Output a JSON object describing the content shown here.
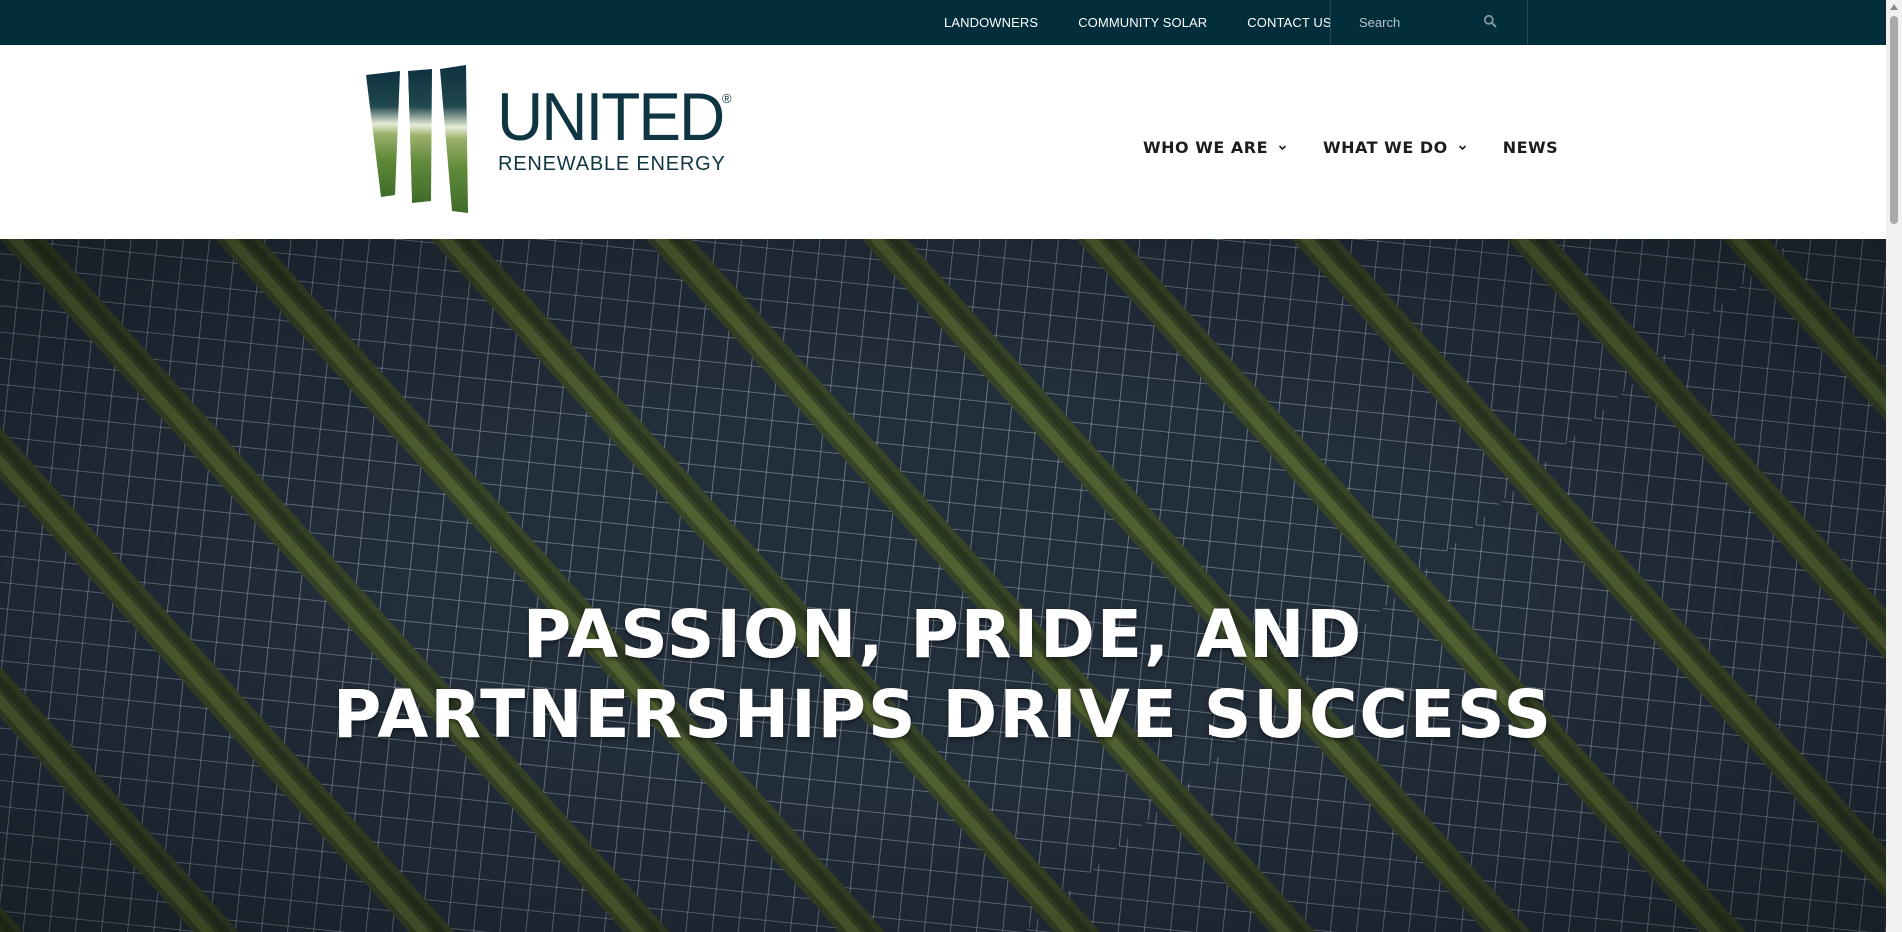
{
  "topbar": {
    "links": [
      {
        "label": "LANDOWNERS"
      },
      {
        "label": "COMMUNITY SOLAR"
      },
      {
        "label": "CONTACT US"
      }
    ],
    "search": {
      "placeholder": "Search",
      "icon": "search-icon"
    }
  },
  "logo": {
    "word": "UNITED",
    "subtitle": "RENEWABLE ENERGY",
    "registered": "®"
  },
  "nav": {
    "items": [
      {
        "label": "WHO WE ARE",
        "has_dropdown": true
      },
      {
        "label": "WHAT WE DO",
        "has_dropdown": true
      },
      {
        "label": "NEWS",
        "has_dropdown": false
      }
    ]
  },
  "hero": {
    "line1": "PASSION, PRIDE, AND",
    "line2": "PARTNERSHIPS DRIVE SUCCESS",
    "image": "aerial-solar-panel-rows"
  },
  "colors": {
    "topbar_bg": "#012e3a",
    "brand_dark": "#0f3542",
    "nav_text": "#1d1d1d",
    "hero_text": "#ffffff"
  }
}
